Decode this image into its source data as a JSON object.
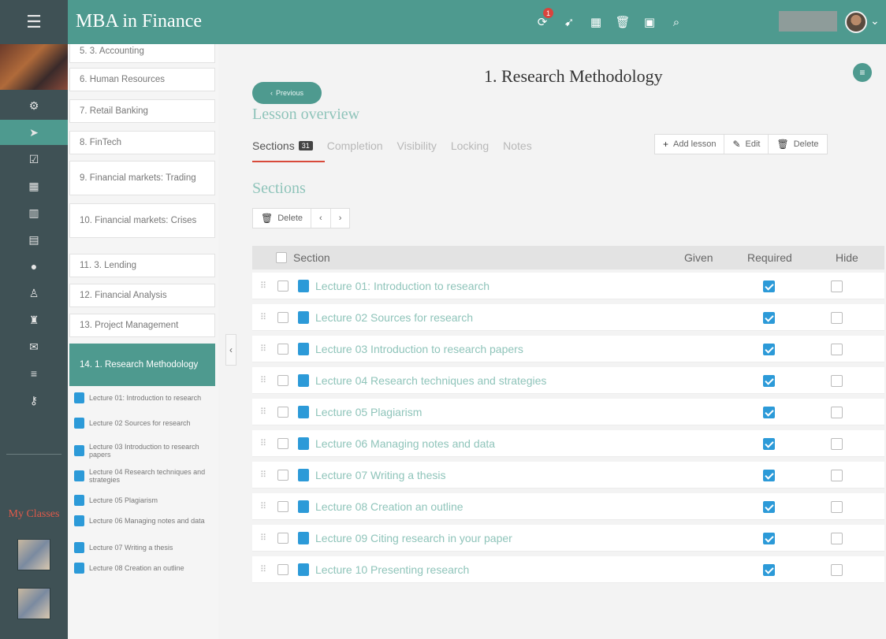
{
  "app": {
    "title": "MBA in Finance",
    "notification_count": "1"
  },
  "rail": {
    "icons": [
      "gear-icon",
      "send-icon",
      "checklist-icon",
      "calendar-icon",
      "chart-icon",
      "grid-icon",
      "user-icon",
      "users-icon",
      "trophy-icon",
      "chat-icon",
      "list-icon",
      "key-icon"
    ],
    "my_classes": "My Classes"
  },
  "lesson_list": {
    "items": [
      "5. 3. Accounting",
      "6. Human Resources",
      "7. Retail Banking",
      "8. FinTech",
      "9. Financial markets: Trading",
      "10. Financial markets: Crises",
      "11. 3. Lending",
      "12. Financial Analysis",
      "13. Project Management",
      "14. 1. Research Methodology"
    ],
    "sub_items": [
      "Lecture 01: Introduction to research",
      "Lecture 02 Sources for research",
      "Lecture 03 Introduction to research papers",
      "Lecture 04 Research techniques and strategies",
      "Lecture 05 Plagiarism",
      "Lecture 06 Managing notes and data",
      "Lecture 07 Writing a thesis",
      "Lecture 08 Creation an outline"
    ]
  },
  "main": {
    "prev_label": "Previous",
    "title": "1. Research Methodology",
    "overview_title": "Lesson overview",
    "tabs": [
      {
        "label": "Sections",
        "count": "31"
      },
      {
        "label": "Completion"
      },
      {
        "label": "Visibility"
      },
      {
        "label": "Locking"
      },
      {
        "label": "Notes"
      }
    ],
    "actions": {
      "add": "Add lesson",
      "edit": "Edit",
      "delete": "Delete"
    },
    "sections_title": "Sections",
    "toolbar": {
      "delete": "Delete"
    },
    "columns": {
      "section": "Section",
      "given": "Given",
      "required": "Required",
      "hide": "Hide"
    },
    "rows": [
      {
        "title": "Lecture 01: Introduction to research",
        "required": true,
        "hide": false
      },
      {
        "title": "Lecture 02 Sources for research",
        "required": true,
        "hide": false
      },
      {
        "title": "Lecture 03 Introduction to research papers",
        "required": true,
        "hide": false
      },
      {
        "title": "Lecture 04 Research techniques and strategies",
        "required": true,
        "hide": false
      },
      {
        "title": "Lecture 05 Plagiarism",
        "required": true,
        "hide": false
      },
      {
        "title": "Lecture 06 Managing notes and data",
        "required": true,
        "hide": false
      },
      {
        "title": "Lecture 07 Writing a thesis",
        "required": true,
        "hide": false
      },
      {
        "title": "Lecture 08 Creation an outline",
        "required": true,
        "hide": false
      },
      {
        "title": "Lecture 09 Citing research in your paper",
        "required": true,
        "hide": false
      },
      {
        "title": "Lecture 10 Presenting research",
        "required": true,
        "hide": false
      }
    ]
  },
  "colors": {
    "brand": "#4e9a8f",
    "rail": "#3f5155",
    "accent_red": "#d84a3a",
    "doc_blue": "#2c9ad8",
    "link_teal": "#8fc4ba"
  }
}
